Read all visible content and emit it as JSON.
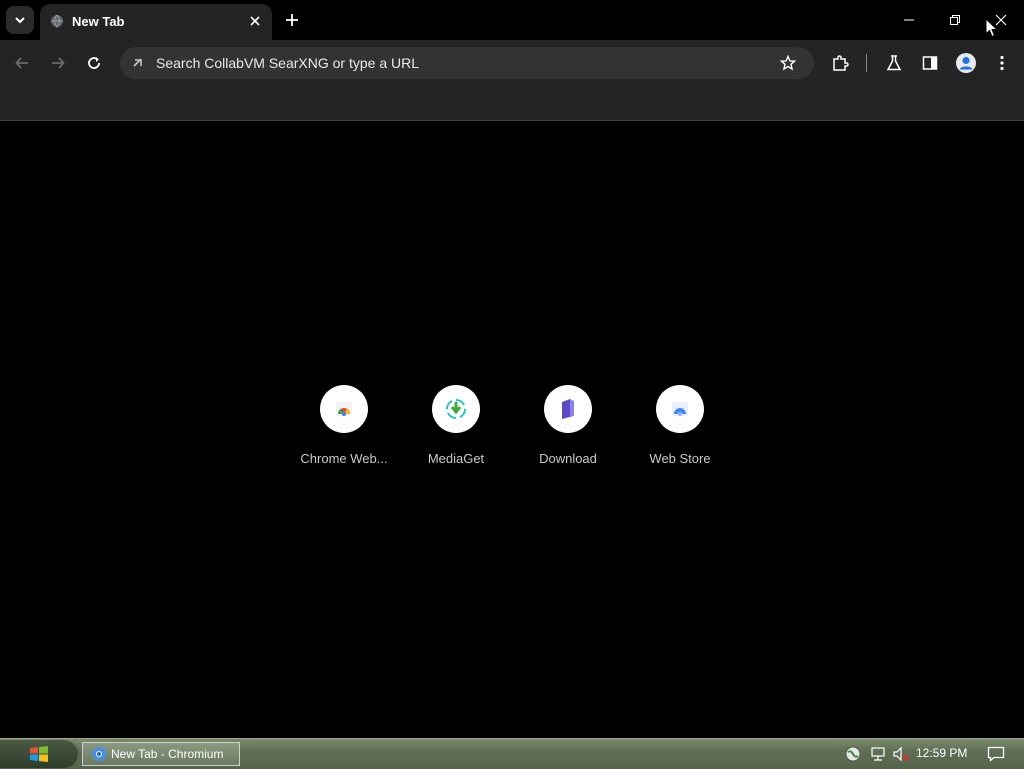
{
  "browser": {
    "tab": {
      "title": "New Tab"
    },
    "omnibox": {
      "placeholder": "Search CollabVM SearXNG or type a URL"
    }
  },
  "shortcuts": [
    {
      "label": "Chrome Web..."
    },
    {
      "label": "MediaGet"
    },
    {
      "label": "Download"
    },
    {
      "label": "Web Store"
    }
  ],
  "taskbar": {
    "window_button": "New Tab - Chromium",
    "clock": "12:59 PM"
  },
  "icons": {
    "tab_search": "chevron-down-icon",
    "tab_favicon": "globe-icon",
    "tab_close": "close-icon",
    "new_tab": "plus-icon",
    "minimize": "minimize-icon",
    "restore": "restore-icon",
    "close_window": "close-icon",
    "back": "arrow-left-icon",
    "forward": "arrow-right-icon",
    "reload": "reload-icon",
    "bookmark": "star-icon",
    "extensions": "puzzle-icon",
    "labs": "flask-icon",
    "side_panel": "side-panel-icon",
    "profile": "profile-icon",
    "menu": "kebab-menu-icon"
  },
  "colors": {
    "titlebar": "#000000",
    "toolbar": "#242424",
    "omnibox": "#333333",
    "content": "#000000",
    "text": "#e8eaed"
  }
}
